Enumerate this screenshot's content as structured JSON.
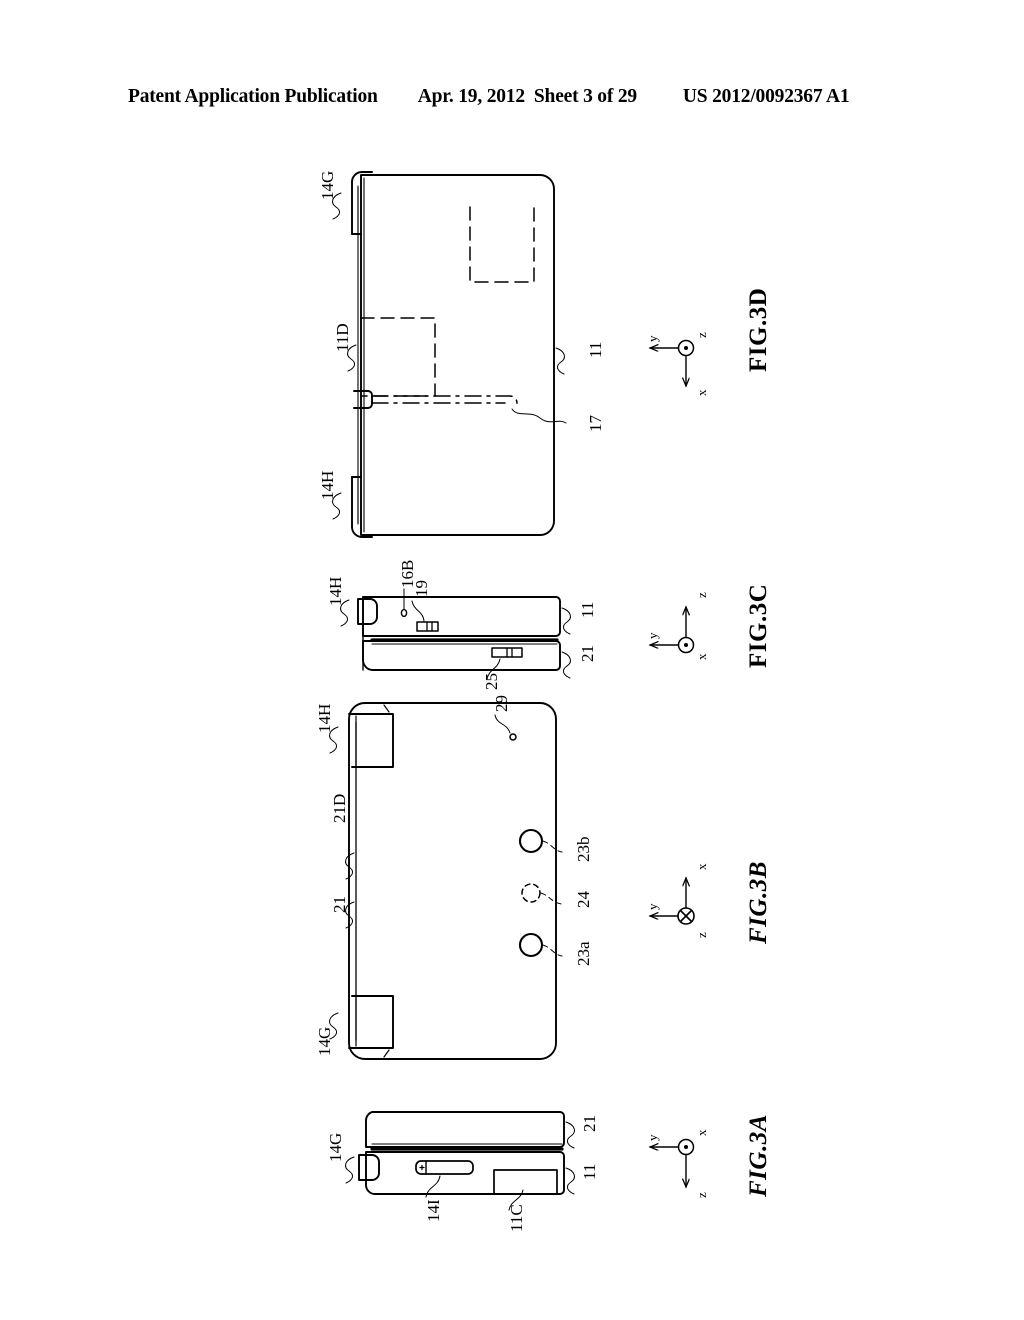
{
  "header": {
    "publication": "Patent Application Publication",
    "date": "Apr. 19, 2012",
    "sheet": "Sheet 3 of 29",
    "publication_number": "US 2012/0092367 A1"
  },
  "page": {
    "orientation": "landscape-drawing-rotated-90",
    "background_color": "#ffffff",
    "line_color": "#000000"
  },
  "figures": [
    {
      "id": "fig-3a",
      "caption": "FIG.3A",
      "caption_style": "italic",
      "view": "side view, device closed",
      "reference_numerals": [
        "14G",
        "14I",
        "11C",
        "11",
        "21"
      ],
      "axis": {
        "out_of_page": "x",
        "marker": "circle-dot",
        "arrows": [
          {
            "label": "y",
            "direction": "left"
          },
          {
            "label": "z",
            "direction": "down"
          }
        ]
      }
    },
    {
      "id": "fig-3b",
      "caption": "FIG.3B",
      "caption_style": "italic",
      "view": "bottom housing outer surface",
      "reference_numerals": [
        "14H",
        "21D",
        "21",
        "14G",
        "29",
        "23b",
        "24",
        "23a"
      ],
      "axis": {
        "into_page": "z",
        "marker": "circle-cross",
        "arrows": [
          {
            "label": "y",
            "direction": "left"
          },
          {
            "label": "x",
            "direction": "up"
          }
        ]
      }
    },
    {
      "id": "fig-3c",
      "caption": "FIG.3C",
      "caption_style": "upright",
      "view": "end view",
      "reference_numerals": [
        "14H",
        "16B",
        "19",
        "11",
        "21",
        "25"
      ],
      "axis": {
        "out_of_page": "x",
        "marker": "circle-dot",
        "arrows": [
          {
            "label": "y",
            "direction": "left"
          },
          {
            "label": "z",
            "direction": "up"
          }
        ]
      }
    },
    {
      "id": "fig-3d",
      "caption": "FIG.3D",
      "caption_style": "upright",
      "view": "upper housing outer surface",
      "reference_numerals": [
        "14G",
        "11D",
        "14H",
        "11",
        "17"
      ],
      "axis": {
        "out_of_page": "z",
        "marker": "circle-dot",
        "arrows": [
          {
            "label": "y",
            "direction": "left"
          },
          {
            "label": "x",
            "direction": "down"
          }
        ]
      }
    }
  ],
  "labels": {
    "f3d_14G": "14G",
    "f3d_11D": "11D",
    "f3d_14H": "14H",
    "f3d_11": "11",
    "f3d_17": "17",
    "f3d_ax_y": "y",
    "f3d_ax_z": "z",
    "f3d_ax_x": "x",
    "f3d_caption": "FIG.3D",
    "f3c_14H": "14H",
    "f3c_16B": "16B",
    "f3c_19": "19",
    "f3c_11": "11",
    "f3c_21": "21",
    "f3c_25": "25",
    "f3c_ax_y": "y",
    "f3c_ax_z": "z",
    "f3c_ax_x": "x",
    "f3c_caption": "FIG.3C",
    "f3b_14H": "14H",
    "f3b_21D": "21D",
    "f3b_21": "21",
    "f3b_14G": "14G",
    "f3b_29": "29",
    "f3b_23b": "23b",
    "f3b_24": "24",
    "f3b_23a": "23a",
    "f3b_ax_y": "y",
    "f3b_ax_x": "x",
    "f3b_ax_z": "z",
    "f3b_caption": "FIG.3B",
    "f3a_14G": "14G",
    "f3a_14I": "14I",
    "f3a_11C": "11C",
    "f3a_11": "11",
    "f3a_21": "21",
    "f3a_ax_y": "y",
    "f3a_ax_z": "z",
    "f3a_ax_x": "x",
    "f3a_caption": "FIG.3A"
  }
}
